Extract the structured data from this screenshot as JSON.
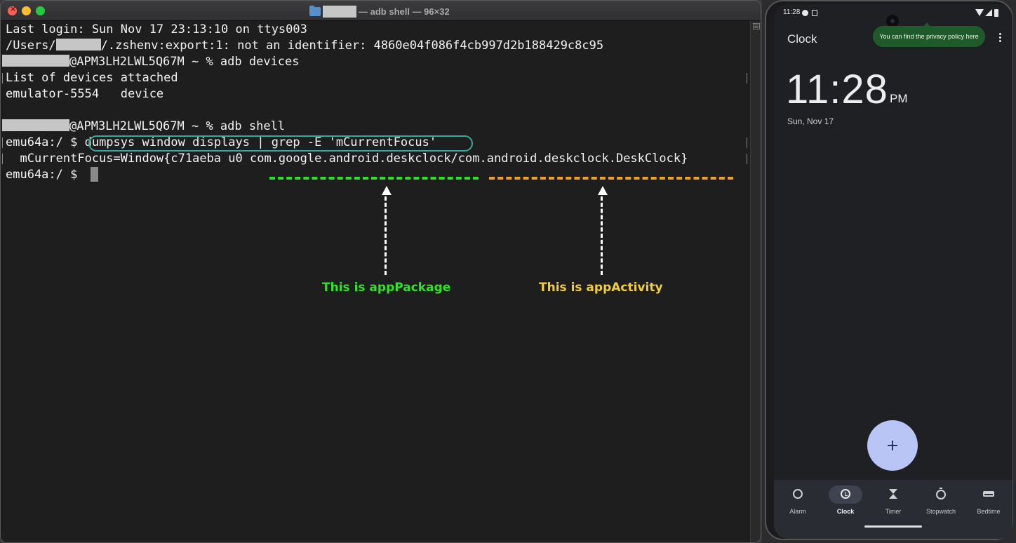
{
  "terminal": {
    "title": "— adb shell — 96×32",
    "lines": {
      "login": "Last login: Sun Nov 17 23:13:10 on ttys003",
      "users_prefix": "/Users/",
      "users_suffix": "/.zshenv:export:1: not an identifier: 4860e04f086f4cb997d2b188429c8c95",
      "prompt1_suffix": "@APM3LH2LWL5Q67M ~ % adb devices",
      "devices_header": "List of devices attached",
      "device_entry": "emulator-5554   device",
      "prompt2_suffix": "@APM3LH2LWL5Q67M ~ % adb shell",
      "shell_prompt": "emu64a:/ $ ",
      "shell_command": "dumpsys window displays | grep -E 'mCurrentFocus'",
      "focus_output": "  mCurrentFocus=Window{c71aeba u0 com.google.android.deskclock/com.android.deskclock.DeskClock}",
      "shell_prompt2": "emu64a:/ $ "
    }
  },
  "annotations": {
    "app_package": "This is appPackage",
    "app_activity": "This is appActivity",
    "colors": {
      "package": "#34e02e",
      "activity": "#f2cf3a",
      "package_dash": "#2ee22a",
      "activity_dash": "#f0a12a"
    }
  },
  "phone": {
    "status_time": "11:28",
    "app_title": "Clock",
    "tooltip": "You can find the privacy policy here",
    "clock_time": "11:28",
    "clock_ampm": "PM",
    "clock_date": "Sun, Nov 17",
    "fab_label": "+",
    "nav": [
      {
        "label": "Alarm",
        "icon": "alarm-icon"
      },
      {
        "label": "Clock",
        "icon": "clock-icon"
      },
      {
        "label": "Timer",
        "icon": "hourglass-icon"
      },
      {
        "label": "Stopwatch",
        "icon": "stopwatch-icon"
      },
      {
        "label": "Bedtime",
        "icon": "bed-icon"
      }
    ]
  }
}
